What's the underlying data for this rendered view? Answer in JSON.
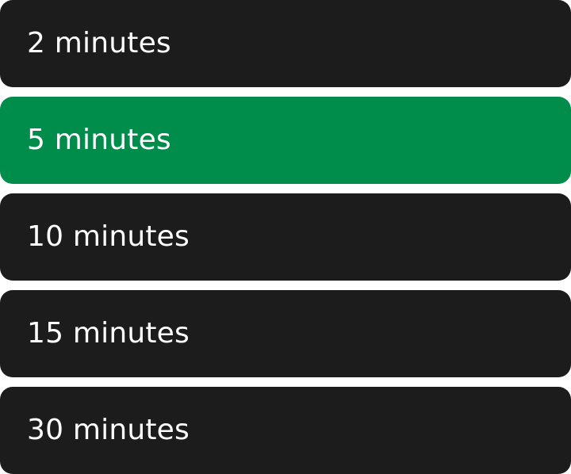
{
  "duration_options": {
    "selected_label": "5 minutes",
    "items": [
      {
        "label": "2 minutes"
      },
      {
        "label": "5 minutes"
      },
      {
        "label": "10 minutes"
      },
      {
        "label": "15 minutes"
      },
      {
        "label": "30 minutes"
      }
    ]
  },
  "colors": {
    "option_background": "#1c1c1c",
    "selected_background": "#008c4b",
    "label_text": "#ffffff"
  }
}
